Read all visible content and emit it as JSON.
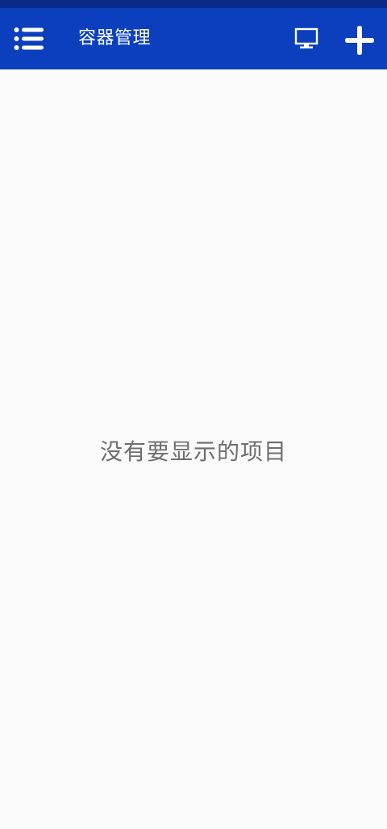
{
  "status_bar": {
    "color": "#0a2a8a"
  },
  "app_bar": {
    "title": "容器管理",
    "background": "#0b3fbd",
    "icons": {
      "menu": "list-menu-icon",
      "display": "monitor-icon",
      "add": "plus-icon"
    }
  },
  "main": {
    "empty_message": "没有要显示的项目"
  }
}
